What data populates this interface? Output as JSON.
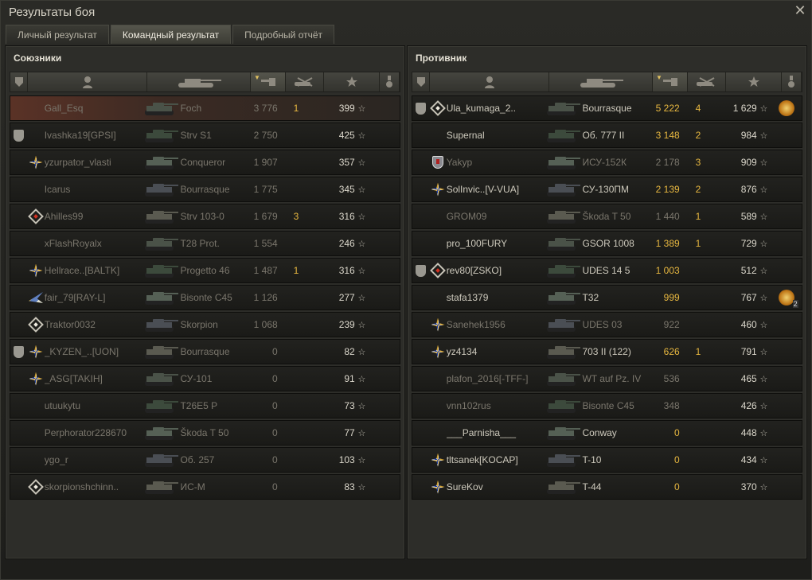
{
  "window": {
    "title": "Результаты боя",
    "close_label": "✕"
  },
  "tabs": [
    {
      "label": "Личный результат",
      "active": false
    },
    {
      "label": "Командный результат",
      "active": true
    },
    {
      "label": "Подробный отчёт",
      "active": false
    }
  ],
  "columns": [
    "squad",
    "player",
    "vehicle",
    "damage",
    "kills",
    "experience",
    "medals"
  ],
  "allies": {
    "title": "Союзники",
    "rows": [
      {
        "squad": false,
        "icon": "",
        "nick": "Gall_Esq",
        "tank": "Foch",
        "damage": "3 776",
        "kills": "1",
        "xp": "399",
        "medal": "",
        "self": true,
        "dead": true
      },
      {
        "squad": true,
        "icon": "",
        "nick": "Ivashka19[GPSI]",
        "tank": "Strv S1",
        "damage": "2 750",
        "kills": "",
        "xp": "425",
        "medal": "",
        "dead": true
      },
      {
        "squad": false,
        "icon": "star",
        "nick": "yzurpator_vlasti",
        "tank": "Conqueror",
        "damage": "1 907",
        "kills": "",
        "xp": "357",
        "medal": "",
        "dead": true
      },
      {
        "squad": false,
        "icon": "",
        "nick": "Icarus",
        "tank": "Bourrasque",
        "damage": "1 775",
        "kills": "",
        "xp": "345",
        "medal": "",
        "dead": true
      },
      {
        "squad": false,
        "icon": "diamond",
        "nick": "Ahilles99",
        "tank": "Strv 103-0",
        "damage": "1 679",
        "kills": "3",
        "xp": "316",
        "medal": "",
        "dead": true
      },
      {
        "squad": false,
        "icon": "",
        "nick": "xFlashRoyalx",
        "tank": "T28 Prot.",
        "damage": "1 554",
        "kills": "",
        "xp": "246",
        "medal": "",
        "dead": true
      },
      {
        "squad": false,
        "icon": "star",
        "nick": "Hellrace..[BALTK]",
        "tank": "Progetto 46",
        "damage": "1 487",
        "kills": "1",
        "xp": "316",
        "medal": "",
        "dead": true
      },
      {
        "squad": false,
        "icon": "bird",
        "nick": "fair_79[RAY-L]",
        "tank": "Bisonte C45",
        "damage": "1 126",
        "kills": "",
        "xp": "277",
        "medal": "",
        "dead": true
      },
      {
        "squad": false,
        "icon": "diamond-plain",
        "nick": "Traktor0032",
        "tank": "Skorpion",
        "damage": "1 068",
        "kills": "",
        "xp": "239",
        "medal": "",
        "dead": true
      },
      {
        "squad": true,
        "icon": "star",
        "nick": "_KYZEN_..[UON]",
        "tank": "Bourrasque",
        "damage": "0",
        "kills": "",
        "xp": "82",
        "medal": "",
        "dead": true
      },
      {
        "squad": false,
        "icon": "star",
        "nick": "_ASG[TAKIH]",
        "tank": "СУ-101",
        "damage": "0",
        "kills": "",
        "xp": "91",
        "medal": "",
        "dead": true
      },
      {
        "squad": false,
        "icon": "",
        "nick": "utuukytu",
        "tank": "T26E5 P",
        "damage": "0",
        "kills": "",
        "xp": "73",
        "medal": "",
        "dead": true
      },
      {
        "squad": false,
        "icon": "",
        "nick": "Perphorator228670",
        "tank": "Škoda T 50",
        "damage": "0",
        "kills": "",
        "xp": "77",
        "medal": "",
        "dead": true
      },
      {
        "squad": false,
        "icon": "",
        "nick": "ygo_r",
        "tank": "Об. 257",
        "damage": "0",
        "kills": "",
        "xp": "103",
        "medal": "",
        "dead": true
      },
      {
        "squad": false,
        "icon": "diamond-plain",
        "nick": "skorpionshchinn..",
        "tank": "ИС-М",
        "damage": "0",
        "kills": "",
        "xp": "83",
        "medal": "",
        "dead": true
      }
    ]
  },
  "enemies": {
    "title": "Противник",
    "rows": [
      {
        "squad": true,
        "icon": "diamond-plain",
        "nick": "Ula_kumaga_2..",
        "tank": "Bourrasque",
        "damage": "5 222",
        "kills": "4",
        "xp": "1 629",
        "medal": "medal",
        "medal_count": "",
        "dead": false
      },
      {
        "squad": false,
        "icon": "",
        "nick": "Supernal",
        "tank": "Об. 777 II",
        "damage": "3 148",
        "kills": "2",
        "xp": "984",
        "medal": "",
        "dead": false
      },
      {
        "squad": false,
        "icon": "shield",
        "nick": "Yakyp",
        "tank": "ИСУ-152К",
        "damage": "2 178",
        "kills": "3",
        "xp": "909",
        "medal": "",
        "dead": true
      },
      {
        "squad": false,
        "icon": "star",
        "nick": "SolInvic..[V-VUA]",
        "tank": "СУ-130ПМ",
        "damage": "2 139",
        "kills": "2",
        "xp": "876",
        "medal": "",
        "dead": false
      },
      {
        "squad": false,
        "icon": "",
        "nick": "GROM09",
        "tank": "Škoda T 50",
        "damage": "1 440",
        "kills": "1",
        "xp": "589",
        "medal": "",
        "dead": true
      },
      {
        "squad": false,
        "icon": "",
        "nick": "pro_100FURY",
        "tank": "GSOR 1008",
        "damage": "1 389",
        "kills": "1",
        "xp": "729",
        "medal": "",
        "dead": false
      },
      {
        "squad": true,
        "icon": "diamond",
        "nick": "rev80[ZSKO]",
        "tank": "UDES 14 5",
        "damage": "1 003",
        "kills": "",
        "xp": "512",
        "medal": "",
        "dead": false
      },
      {
        "squad": false,
        "icon": "",
        "nick": "stafa1379",
        "tank": "T32",
        "damage": "999",
        "kills": "",
        "xp": "767",
        "medal": "medal",
        "medal_count": "2",
        "dead": false
      },
      {
        "squad": false,
        "icon": "star",
        "nick": "Sanehek1956",
        "tank": "UDES 03",
        "damage": "922",
        "kills": "",
        "xp": "460",
        "medal": "",
        "dead": true
      },
      {
        "squad": false,
        "icon": "star",
        "nick": "yz4134",
        "tank": "703 II (122)",
        "damage": "626",
        "kills": "1",
        "xp": "791",
        "medal": "",
        "dead": false
      },
      {
        "squad": false,
        "icon": "",
        "nick": "plafon_2016[-TFF-]",
        "tank": "WT auf Pz. IV",
        "damage": "536",
        "kills": "",
        "xp": "465",
        "medal": "",
        "dead": true
      },
      {
        "squad": false,
        "icon": "",
        "nick": "vnn102rus",
        "tank": "Bisonte C45",
        "damage": "348",
        "kills": "",
        "xp": "426",
        "medal": "",
        "dead": true
      },
      {
        "squad": false,
        "icon": "",
        "nick": "___Parnisha___",
        "tank": "Conway",
        "damage": "0",
        "kills": "",
        "xp": "448",
        "medal": "",
        "dead": false
      },
      {
        "squad": false,
        "icon": "star",
        "nick": "tltsanek[KOCAP]",
        "tank": "T-10",
        "damage": "0",
        "kills": "",
        "xp": "434",
        "medal": "",
        "dead": false
      },
      {
        "squad": false,
        "icon": "star",
        "nick": "SureKov",
        "tank": "T-44",
        "damage": "0",
        "kills": "",
        "xp": "370",
        "medal": "",
        "dead": false
      }
    ]
  }
}
